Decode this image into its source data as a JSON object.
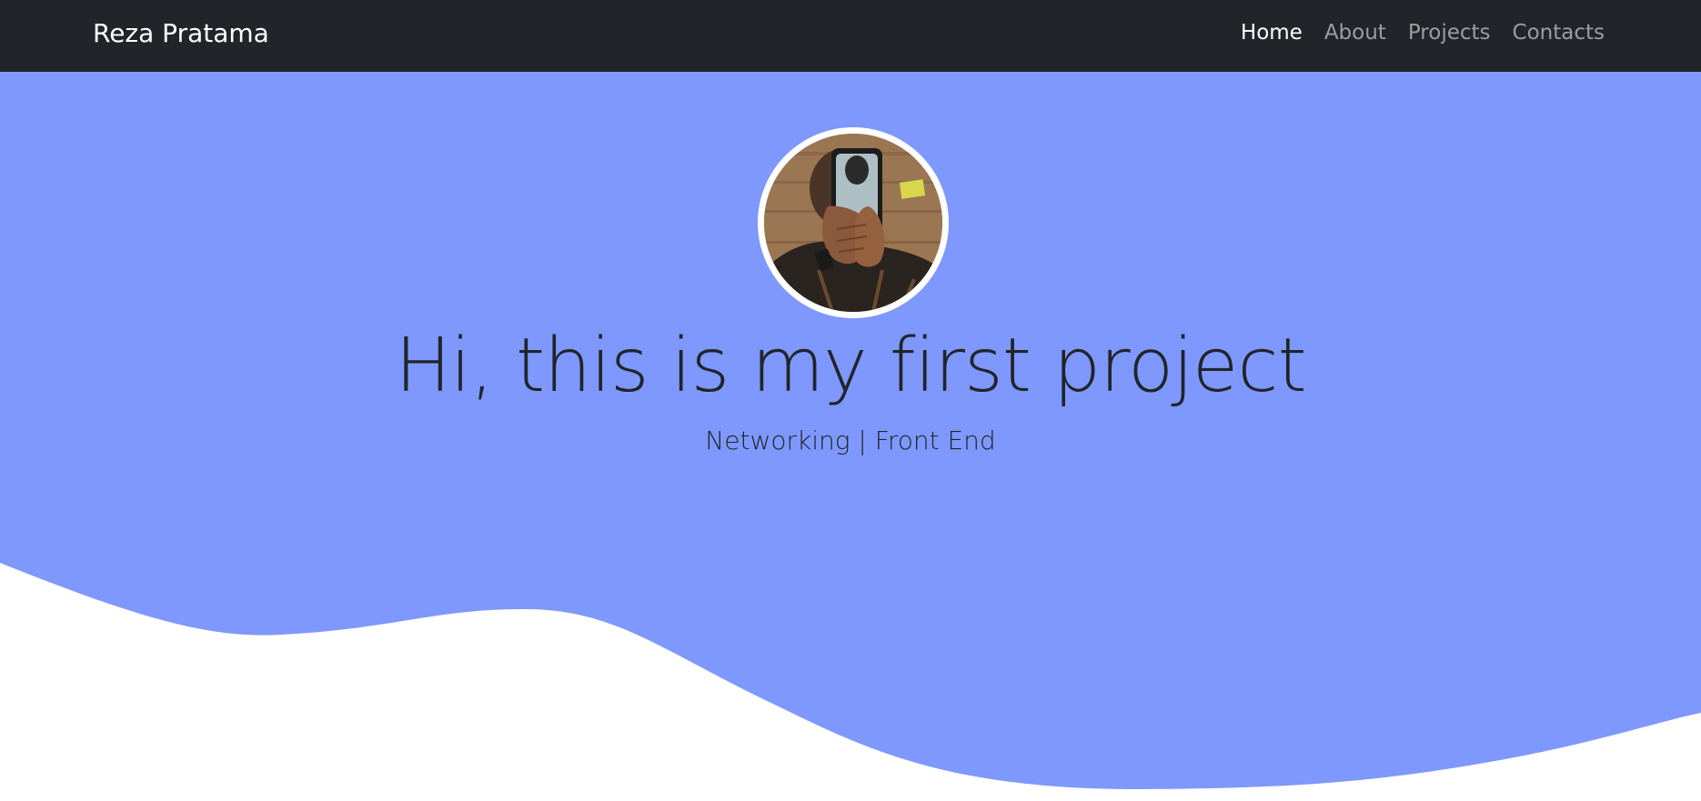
{
  "navbar": {
    "brand": "Reza Pratama",
    "links": [
      {
        "label": "Home",
        "active": true
      },
      {
        "label": "About",
        "active": false
      },
      {
        "label": "Projects",
        "active": false
      },
      {
        "label": "Contacts",
        "active": false
      }
    ]
  },
  "hero": {
    "title": "Hi, this is my first project",
    "subtitle": "Networking | Front End",
    "avatar_icon": "profile-photo",
    "background_color": "#7f98fd"
  },
  "colors": {
    "navbar_bg": "#212529",
    "hero_bg": "#7f98fd",
    "text_dark": "#212529",
    "link_active": "#ffffff",
    "link_inactive": "rgba(255,255,255,0.55)"
  }
}
